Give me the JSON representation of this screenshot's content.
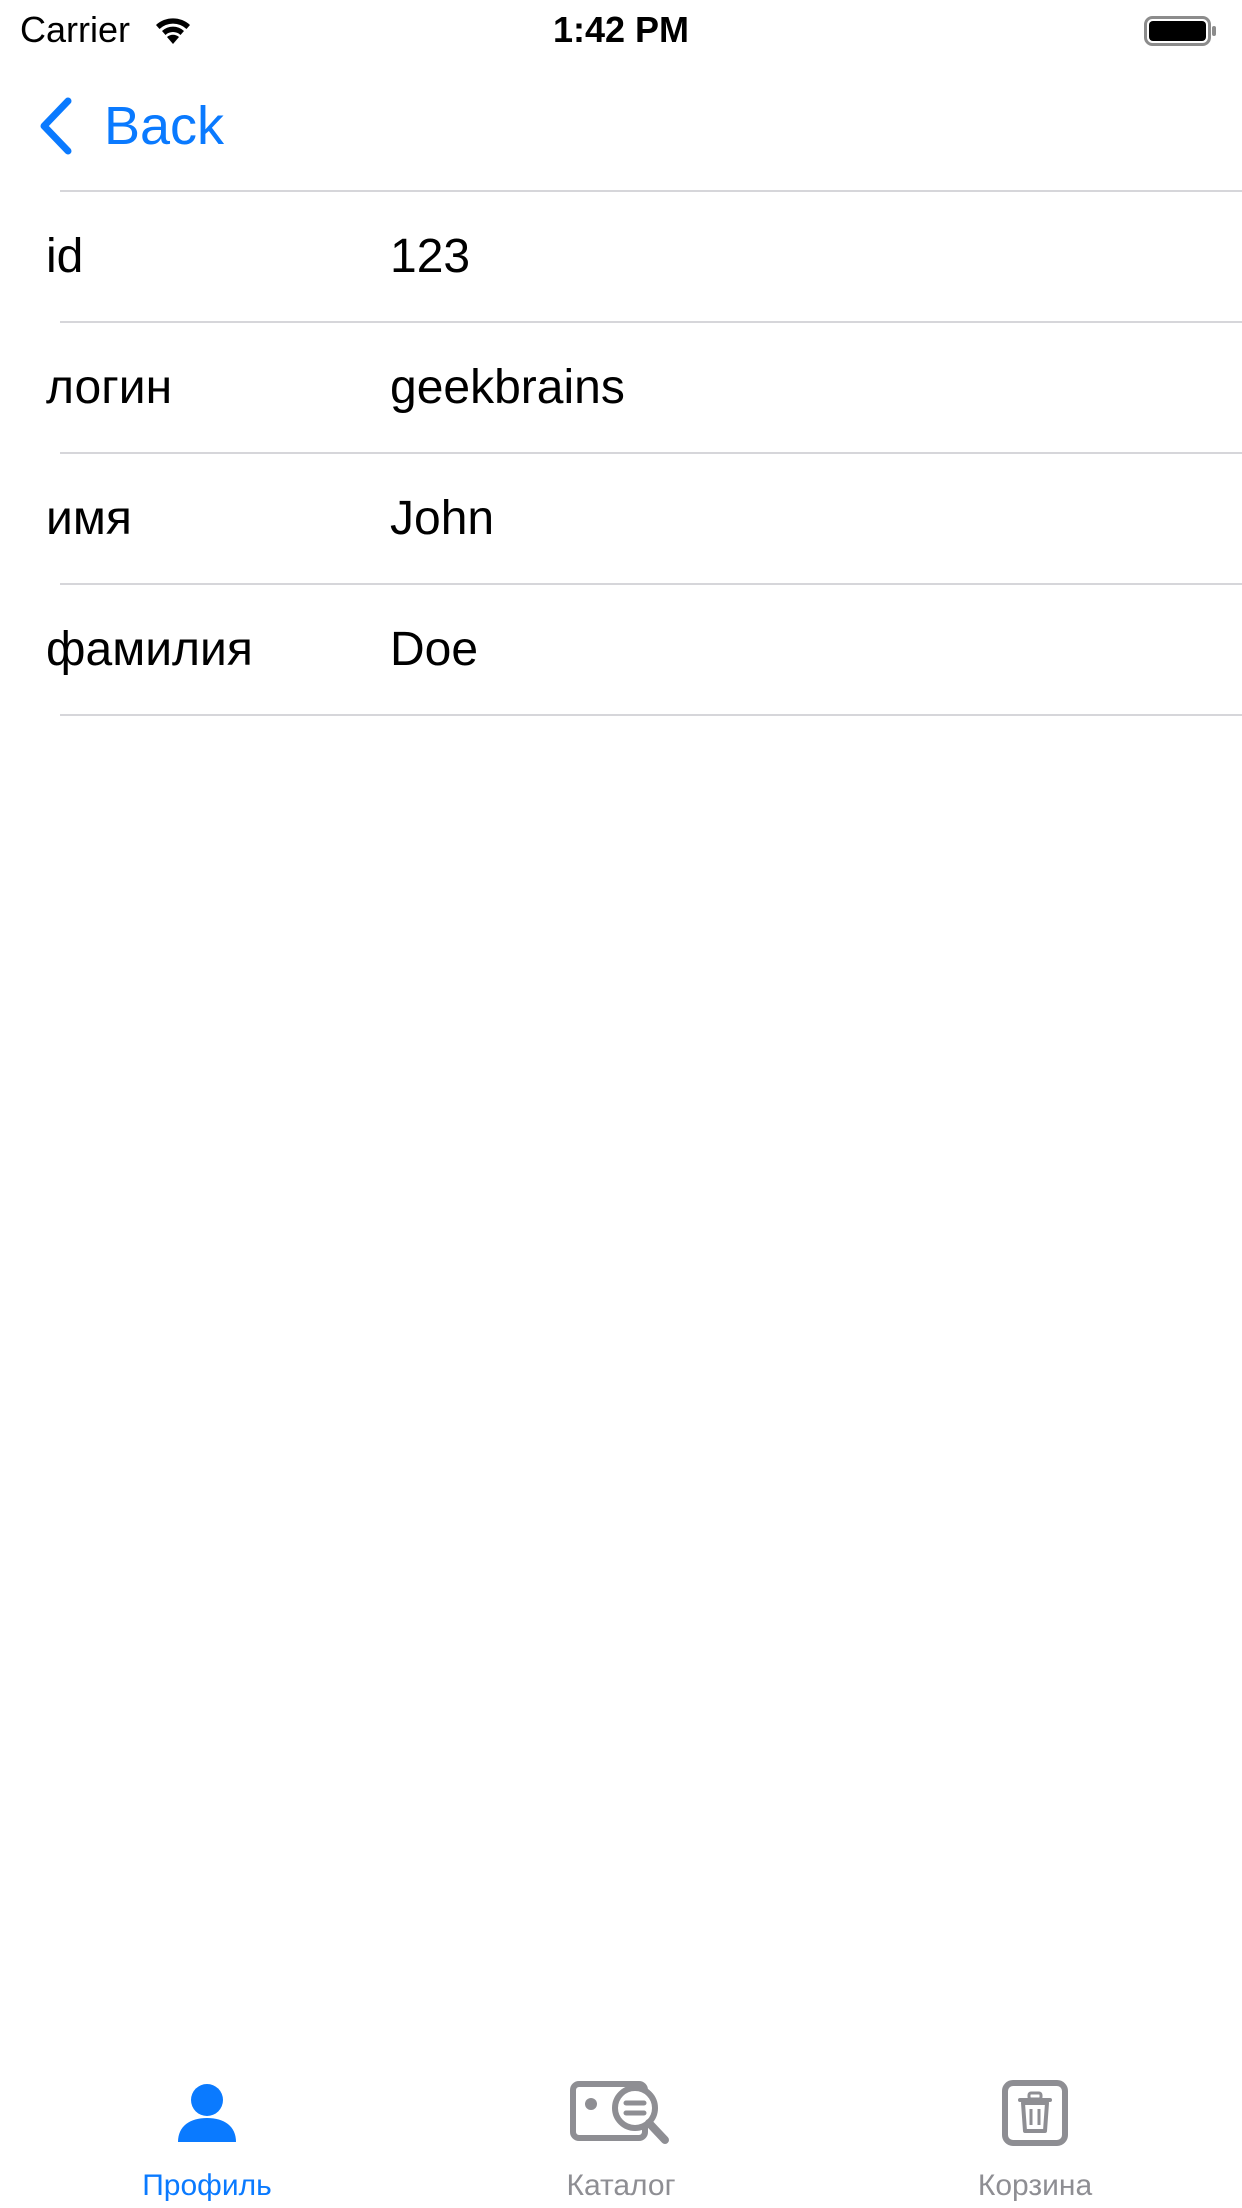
{
  "status_bar": {
    "carrier": "Carrier",
    "time": "1:42 PM"
  },
  "nav": {
    "back_label": "Back"
  },
  "profile_rows": [
    {
      "key": "id",
      "value": "123"
    },
    {
      "key": "логин",
      "value": "geekbrains"
    },
    {
      "key": "имя",
      "value": "John"
    },
    {
      "key": "фамилия",
      "value": "Doe"
    }
  ],
  "tab_bar": {
    "tabs": [
      {
        "label": "Профиль",
        "icon": "person-icon",
        "active": true
      },
      {
        "label": "Каталог",
        "icon": "catalog-search-icon",
        "active": false
      },
      {
        "label": "Корзина",
        "icon": "trash-icon",
        "active": false
      }
    ]
  },
  "colors": {
    "accent": "#0a7aff",
    "inactive": "#8e8e93",
    "separator": "#d6d6da"
  }
}
